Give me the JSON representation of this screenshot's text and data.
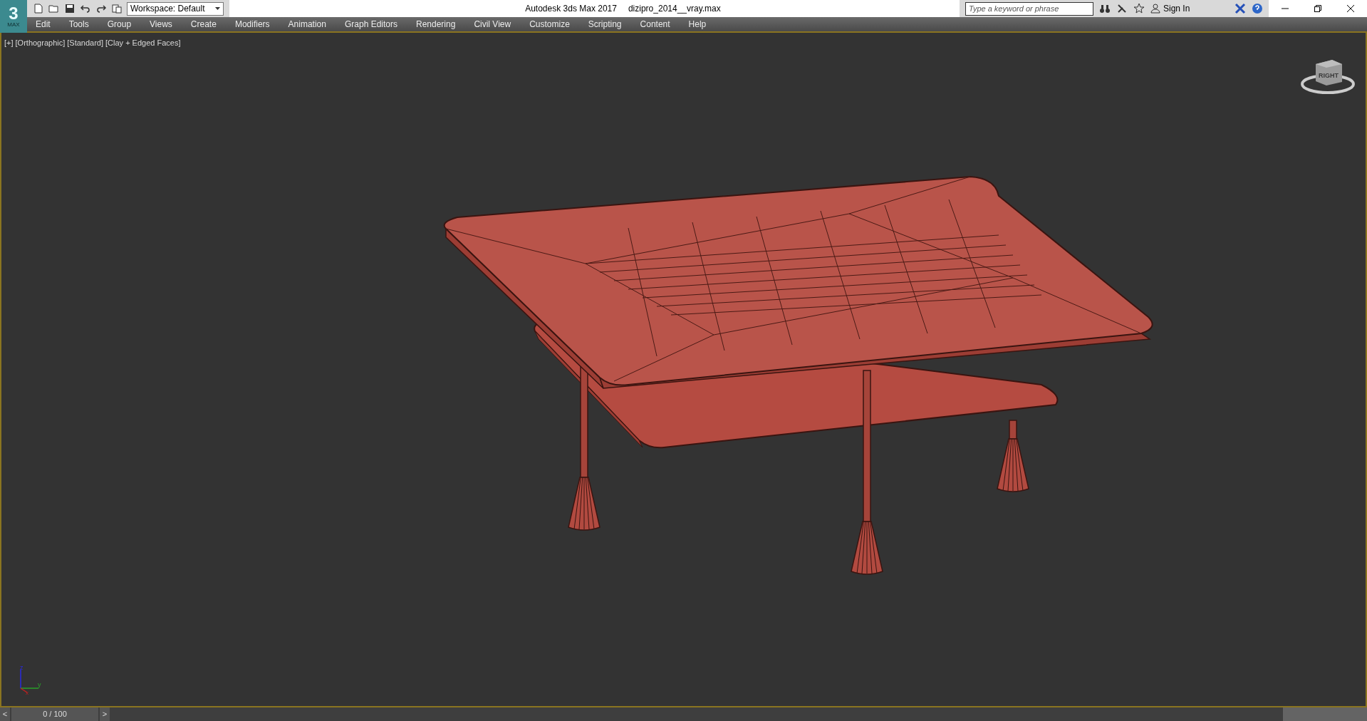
{
  "title_bar": {
    "workspace": "Workspace: Default",
    "app_title": "Autodesk 3ds Max 2017",
    "file_name": "dizipro_2014__vray.max",
    "search": {
      "placeholder": "Type a keyword or phrase"
    },
    "sign_in": "Sign In",
    "logo_mark": "3",
    "logo_caption": "MAX"
  },
  "menu": [
    "Edit",
    "Tools",
    "Group",
    "Views",
    "Create",
    "Modifiers",
    "Animation",
    "Graph Editors",
    "Rendering",
    "Civil View",
    "Customize",
    "Scripting",
    "Content",
    "Help"
  ],
  "viewport": {
    "labels": [
      "[+]",
      "[Orthographic]",
      "[Standard]",
      "[Clay + Edged Faces]"
    ],
    "view_cube": "RIGHT",
    "axes": [
      "z",
      "y",
      "x"
    ]
  },
  "time_slider": {
    "prev": "<",
    "position": "0 / 100",
    "next": ">",
    "level": 0
  }
}
